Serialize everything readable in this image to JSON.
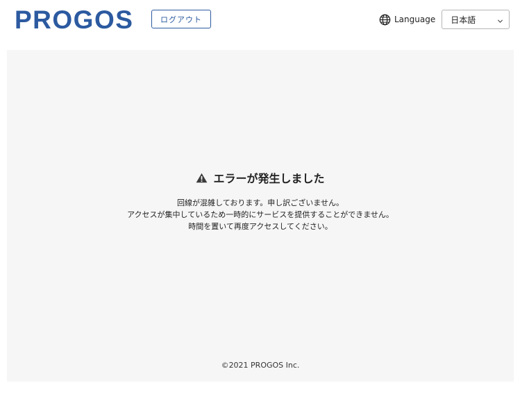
{
  "header": {
    "logo": "PROGOS",
    "logout_label": "ログアウト",
    "language_icon": "globe-icon",
    "language_label": "Language",
    "language_select": {
      "selected": "日本語",
      "options": [
        "日本語"
      ]
    }
  },
  "error": {
    "icon": "warning-icon",
    "title": "エラーが発生しました",
    "message_lines": [
      "回線が混雑しております。申し訳ございません。",
      "アクセスが集中しているため一時的にサービスを提供することができません。",
      "時間を置いて再度アクセスしてください。"
    ]
  },
  "footer": {
    "copyright": "©2021 PROGOS Inc."
  },
  "colors": {
    "brand": "#2c5aa0",
    "panel_background": "#f6f6f6",
    "text": "#222222"
  }
}
